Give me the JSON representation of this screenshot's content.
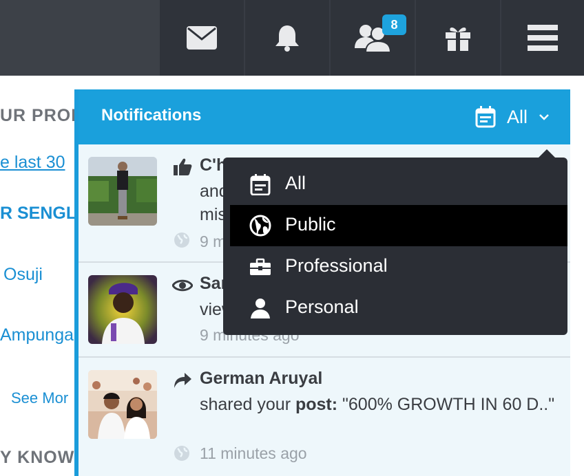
{
  "topbar": {
    "icons": [
      "envelope-icon",
      "bell-icon",
      "friends-icon",
      "gift-icon",
      "menu-icon"
    ],
    "friends_badge": "8"
  },
  "background": {
    "heading_profile": "UR PROF",
    "link_last30": "e last 30",
    "heading_sengla": "R SENGLA",
    "person_osuji": "Osuji",
    "person_ampunga": "Ampunga",
    "see_more": "See Mor",
    "heading_know": "Y KNOW"
  },
  "panel": {
    "title": "Notifications",
    "filter_label": "All",
    "notifications": [
      {
        "name": "C'h",
        "text_line1": "and",
        "text_line2": "mis",
        "time": "9 m",
        "action_icon": "thumbs-up-icon"
      },
      {
        "name": "Sar",
        "text_line1": "view",
        "time": "9 minutes ago",
        "action_icon": "eye-icon"
      },
      {
        "name": "German Aruyal",
        "text_prefix": "shared your ",
        "text_bold": "post:",
        "text_rest": " \"600% GROWTH IN 60 D..\"",
        "time": "11 minutes ago",
        "action_icon": "share-icon"
      }
    ]
  },
  "dropdown": {
    "items": [
      {
        "label": "All",
        "icon": "calendar-list-icon",
        "active": false
      },
      {
        "label": "Public",
        "icon": "globe-icon",
        "active": true
      },
      {
        "label": "Professional",
        "icon": "briefcase-icon",
        "active": false
      },
      {
        "label": "Personal",
        "icon": "person-icon",
        "active": false
      }
    ]
  },
  "colors": {
    "topbar": "#383c44",
    "accent": "#1aa0dc",
    "dropdown": "#2b2e35",
    "panel_bg": "#eef7fb"
  }
}
